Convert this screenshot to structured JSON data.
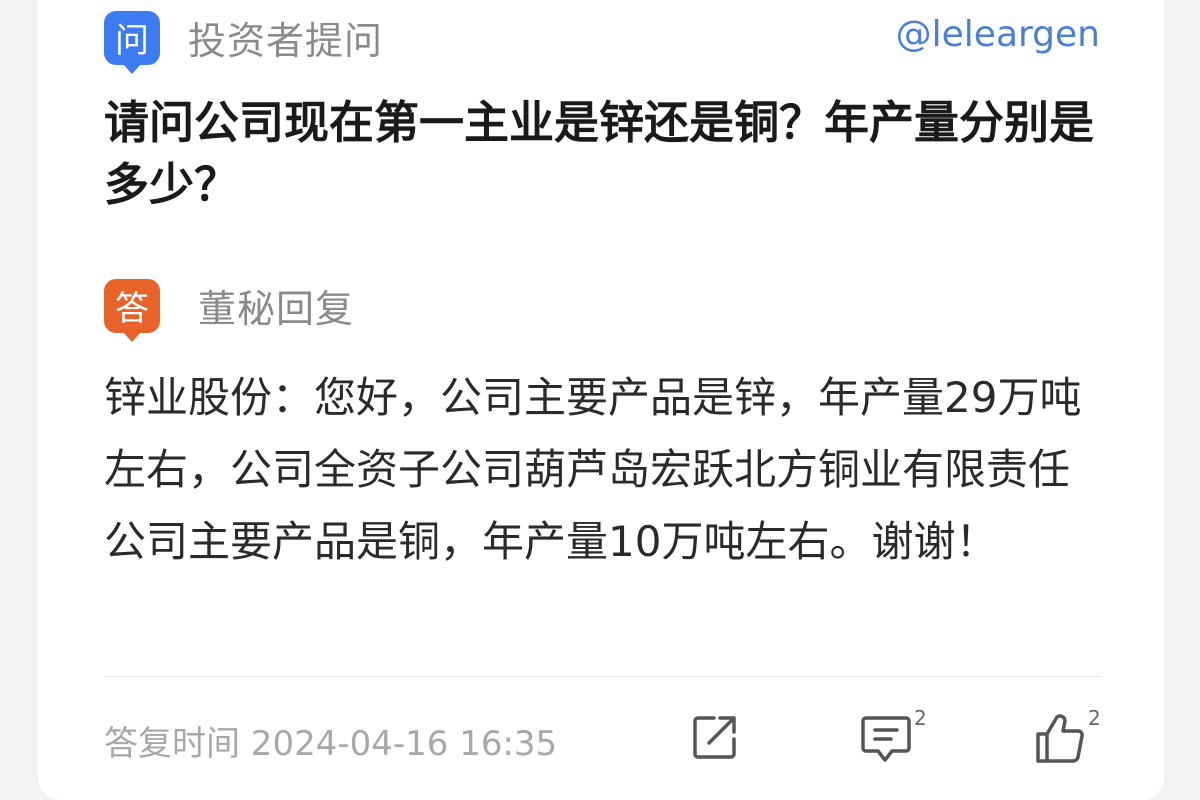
{
  "question": {
    "badge": "问",
    "label": "投资者提问",
    "handle": "@leleargen",
    "text": "请问公司现在第一主业是锌还是铜？年产量分别是多少？"
  },
  "answer": {
    "badge": "答",
    "label": "董秘回复",
    "text": "锌业股份：您好，公司主要产品是锌，年产量29万吨左右，公司全资子公司葫芦岛宏跃北方铜业有限责任公司主要产品是铜，年产量10万吨左右。谢谢！"
  },
  "footer": {
    "time_label": "答复时间 2024-04-16 16:35",
    "share_icon": "share-icon",
    "comment_icon": "comment-icon",
    "comment_count": "2",
    "like_icon": "thumbs-up-icon",
    "like_count": "2"
  },
  "colors": {
    "question_badge": "#3d7cf0",
    "answer_badge": "#e8632a",
    "handle": "#4a7fd8"
  }
}
